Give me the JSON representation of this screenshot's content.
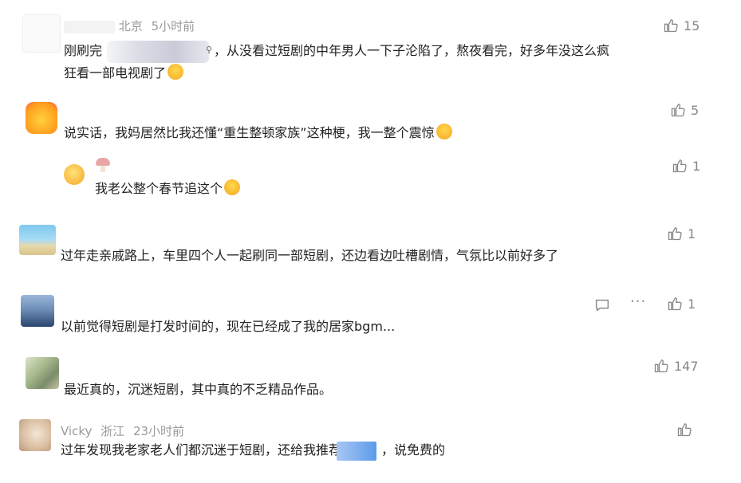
{
  "comments": [
    {
      "location": "北京",
      "time": "5小时前",
      "text1": "刚刷完",
      "text2": "，从没看过短剧的中年男人一下子沦陷了，熬夜看完，好多年没这么疯",
      "text3": "狂看一部电视剧了",
      "likes": "15"
    },
    {
      "text": "说实话，我妈居然比我还懂“重生整顿家族”这种梗，我一整个震惊",
      "likes": "5"
    },
    {
      "text": "我老公整个春节追这个",
      "likes": "1"
    },
    {
      "text": "过年走亲戚路上，车里四个人一起刷同一部短剧，还边看边吐槽剧情，气氛比以前好多了",
      "likes": "1"
    },
    {
      "text": "以前觉得短剧是打发时间的，现在已经成了我的居家bgm...",
      "likes": "1",
      "more": "···"
    },
    {
      "text": "最近真的，沉迷短剧，其中真的不乏精品作品。",
      "likes": "147"
    },
    {
      "user": "Vicky",
      "location": "浙江",
      "time": "23小时前",
      "text1": "过年发现我老家老人们都沉迷于短剧，还给我推荐",
      "text2": "，说免费的"
    }
  ],
  "colors": {
    "meta": "#999999",
    "text": "#222222",
    "like": "#888888",
    "blur_blue": "#5b9bea"
  },
  "icons": {
    "like": "thumbs-up-icon",
    "reply": "comment-icon",
    "more": "more-icon",
    "search": "search-icon"
  }
}
